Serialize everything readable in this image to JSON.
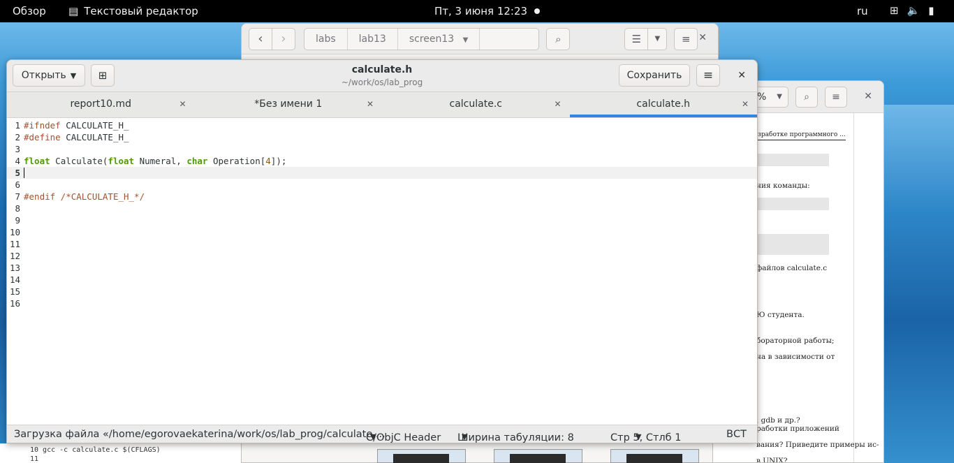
{
  "topbar": {
    "overview": "Обзор",
    "app_name": "Текстовый редактор",
    "clock": "Пт, 3 июня  12:23",
    "lang": "ru"
  },
  "file_manager": {
    "path": [
      "labs",
      "lab13",
      "screen13"
    ]
  },
  "doc_viewer": {
    "zoom": "%",
    "lines": [
      "зработке программного ...",
      "ния команды:",
      "файлов calculate.c",
      "Ю студента.",
      "бораторной работы;",
      "на в зависимости от",
      ", gdb и др.?",
      "работки приложений",
      "вания? Приведите примеры ис-",
      "в UNIX?"
    ]
  },
  "editor": {
    "open_label": "Открыть",
    "save_label": "Сохранить",
    "title": "calculate.h",
    "subtitle": "~/work/os/lab_prog",
    "tabs": [
      {
        "label": "report10.md"
      },
      {
        "label": "*Без имени 1"
      },
      {
        "label": "calculate.c"
      },
      {
        "label": "calculate.h"
      }
    ],
    "lines": [
      {
        "num": "1",
        "text": "#ifndef CALCULATE_H_"
      },
      {
        "num": "2",
        "text": "#define CALCULATE_H_"
      },
      {
        "num": "3",
        "text": ""
      },
      {
        "num": "4",
        "text": "float Calculate(float Numeral, char Operation[4]);"
      },
      {
        "num": "5",
        "text": ""
      },
      {
        "num": "6",
        "text": ""
      },
      {
        "num": "7",
        "text": "#endif /*CALCULATE_H_*/"
      },
      {
        "num": "8",
        "text": ""
      },
      {
        "num": "9",
        "text": ""
      },
      {
        "num": "10",
        "text": ""
      },
      {
        "num": "11",
        "text": ""
      },
      {
        "num": "12",
        "text": ""
      },
      {
        "num": "13",
        "text": ""
      },
      {
        "num": "14",
        "text": ""
      },
      {
        "num": "15",
        "text": ""
      },
      {
        "num": "16",
        "text": ""
      }
    ],
    "status": {
      "message": "Загрузка файла «/home/egorovaekaterina/work/os/lab_prog/calculate....",
      "language": "C/ObjC Header",
      "tab_width": "Ширина табуляции: 8",
      "position": "Стр 5, Стлб 1",
      "mode": "ВСТ"
    }
  },
  "terminal": {
    "line1": "10 gcc -c calculate.c $(CFLAGS)",
    "line2": "11"
  }
}
